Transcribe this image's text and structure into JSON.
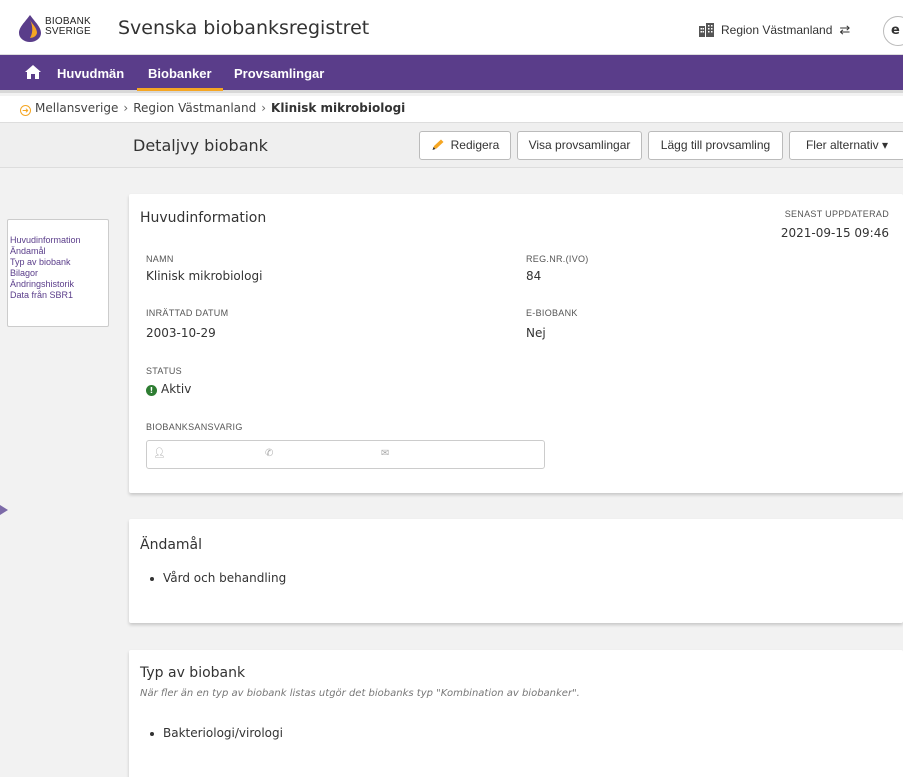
{
  "header": {
    "logo_line1": "BIOBANK",
    "logo_line2": "SVERIGE",
    "title": "Svenska biobanksregistret",
    "region": "Region Västmanland",
    "swap_symbol": "⇄",
    "user_initial": "e"
  },
  "nav": {
    "items": [
      "Huvudmän",
      "Biobanker",
      "Provsamlingar"
    ],
    "active": "Biobanker",
    "accent_color": "#f5a623",
    "bar_color": "#5a3d8a"
  },
  "breadcrumb": {
    "items": [
      "Mellansverige",
      "Region Västmanland",
      "Klinisk mikrobiologi"
    ]
  },
  "toolbar": {
    "title": "Detaljvy biobank",
    "edit": "Redigera",
    "show_collections": "Visa provsamlingar",
    "add_collection": "Lägg till provsamling",
    "more": "Fler alternativ ▾"
  },
  "sidenav": {
    "items": [
      "Huvudinformation",
      "Ändamål",
      "Typ av biobank",
      "Bilagor",
      "Ändringshistorik",
      "Data från SBR1"
    ]
  },
  "main": {
    "title": "Huvudinformation",
    "updated_label": "SENAST UPPDATERAD",
    "updated_value": "2021-09-15 09:46",
    "name_label": "NAMN",
    "name_value": "Klinisk mikrobiologi",
    "reg_label": "REG.NR.(IVO)",
    "reg_value": "84",
    "created_label": "INRÄTTAD DATUM",
    "created_value": "2003-10-29",
    "ebiobank_label": "E-BIOBANK",
    "ebiobank_value": "Nej",
    "status_label": "STATUS",
    "status_value": "Aktiv",
    "status_color": "#2e7d32",
    "responsible_label": "BIOBANKSANSVARIG"
  },
  "purpose": {
    "title": "Ändamål",
    "items": [
      "Vård och behandling"
    ]
  },
  "type": {
    "title": "Typ av biobank",
    "note": "När fler än en typ av biobank listas utgör det biobanks typ \"Kombination av biobanker\".",
    "items": [
      "Bakteriologi/virologi"
    ]
  }
}
